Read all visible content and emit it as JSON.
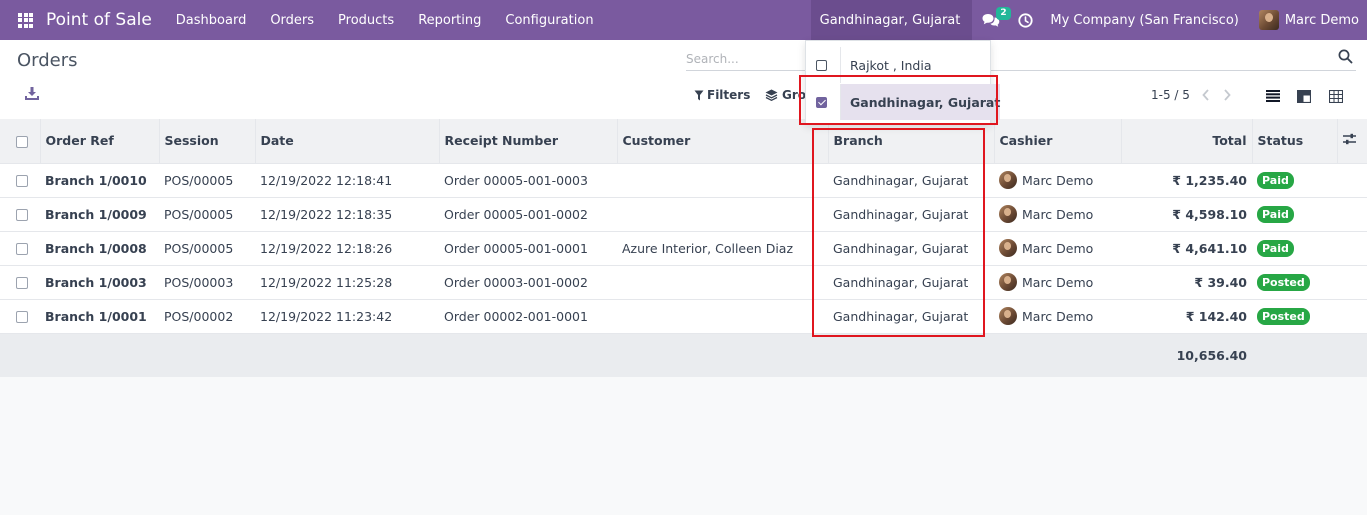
{
  "navbar": {
    "app_name": "Point of Sale",
    "menu": [
      "Dashboard",
      "Orders",
      "Products",
      "Reporting",
      "Configuration"
    ],
    "branch": "Gandhinagar, Gujarat",
    "messages_count": "2",
    "company": "My Company (San Francisco)",
    "user": "Marc Demo",
    "color": "#7a5a9f"
  },
  "control_panel": {
    "title": "Orders",
    "search_placeholder": "Search...",
    "filters_label": "Filters",
    "groupby_label": "Group By",
    "pager": "1-5 / 5",
    "views": [
      "list-view-icon",
      "kanban-view-icon",
      "pivot-view-icon"
    ]
  },
  "branch_dropdown": {
    "items": [
      {
        "label": "Rajkot , India",
        "checked": false
      },
      {
        "label": "Gandhinagar, Gujarat",
        "checked": true
      }
    ]
  },
  "table": {
    "columns": [
      "Order Ref",
      "Session",
      "Date",
      "Receipt Number",
      "Customer",
      "Branch",
      "Cashier",
      "Total",
      "Status"
    ],
    "rows": [
      {
        "ref": "Branch 1/0010",
        "session": "POS/00005",
        "date": "12/19/2022 12:18:41",
        "receipt": "Order 00005-001-0003",
        "customer": "",
        "branch": "Gandhinagar, Gujarat",
        "cashier": "Marc Demo",
        "total": "₹ 1,235.40",
        "status": "Paid"
      },
      {
        "ref": "Branch 1/0009",
        "session": "POS/00005",
        "date": "12/19/2022 12:18:35",
        "receipt": "Order 00005-001-0002",
        "customer": "",
        "branch": "Gandhinagar, Gujarat",
        "cashier": "Marc Demo",
        "total": "₹ 4,598.10",
        "status": "Paid"
      },
      {
        "ref": "Branch 1/0008",
        "session": "POS/00005",
        "date": "12/19/2022 12:18:26",
        "receipt": "Order 00005-001-0001",
        "customer": "Azure Interior, Colleen Diaz",
        "branch": "Gandhinagar, Gujarat",
        "cashier": "Marc Demo",
        "total": "₹ 4,641.10",
        "status": "Paid"
      },
      {
        "ref": "Branch 1/0003",
        "session": "POS/00003",
        "date": "12/19/2022 11:25:28",
        "receipt": "Order 00003-001-0002",
        "customer": "",
        "branch": "Gandhinagar, Gujarat",
        "cashier": "Marc Demo",
        "total": "₹ 39.40",
        "status": "Posted"
      },
      {
        "ref": "Branch 1/0001",
        "session": "POS/00002",
        "date": "12/19/2022 11:23:42",
        "receipt": "Order 00002-001-0001",
        "customer": "",
        "branch": "Gandhinagar, Gujarat",
        "cashier": "Marc Demo",
        "total": "₹ 142.40",
        "status": "Posted"
      }
    ],
    "footer_total": "10,656.40",
    "status_color": "#27a745"
  }
}
